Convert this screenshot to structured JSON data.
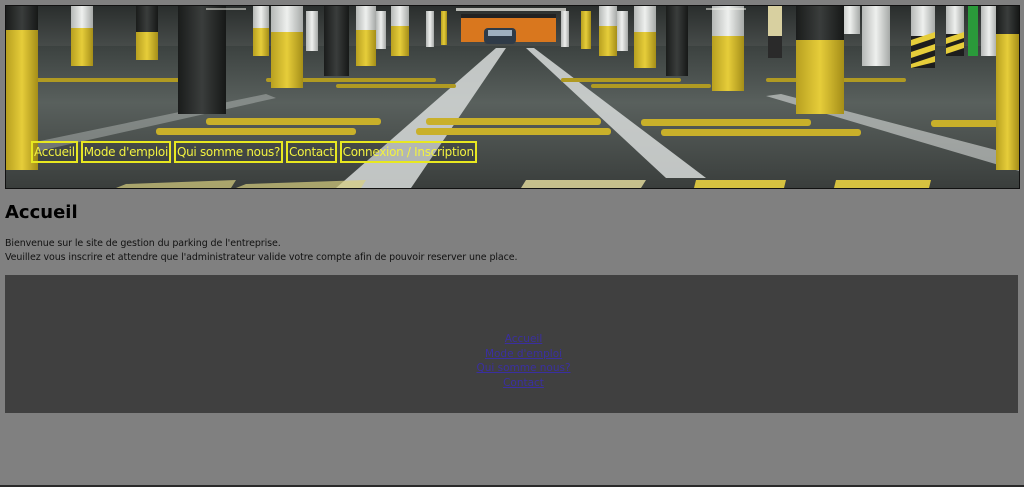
{
  "nav": {
    "items": [
      {
        "label": "Accueil"
      },
      {
        "label": "Mode d'emploi"
      },
      {
        "label": "Qui somme nous?"
      },
      {
        "label": "Contact"
      },
      {
        "label": "Connexion / Inscription"
      }
    ]
  },
  "main": {
    "title": "Accueil",
    "intro_line_1": "Bienvenue sur le site de gestion du parking de l'entreprise.",
    "intro_line_2": "Veuillez vous inscrire et attendre que l'administrateur valide votre compte afin de pouvoir reserver une place."
  },
  "footer": {
    "links": [
      {
        "label": "Accueil"
      },
      {
        "label": "Mode d'emploi"
      },
      {
        "label": "Qui somme nous?"
      },
      {
        "label": "Contact"
      }
    ]
  },
  "colors": {
    "page_background": "#808080",
    "footer_background": "#404040",
    "nav_accent": "#e8e820",
    "footer_link": "#3a2fa0"
  }
}
